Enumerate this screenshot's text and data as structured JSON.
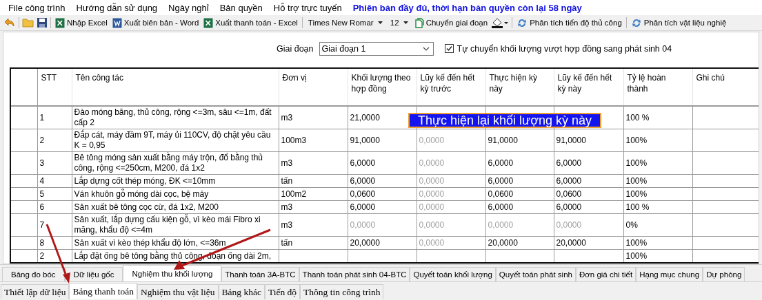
{
  "menu": [
    {
      "label": "File công trình",
      "kind": "normal"
    },
    {
      "label": "Hướng dẫn sử dụng",
      "kind": "normal"
    },
    {
      "label": "Ngày nghỉ",
      "kind": "normal"
    },
    {
      "label": "Bản quyền",
      "kind": "normal"
    },
    {
      "label": "Hỗ trợ trực tuyến",
      "kind": "normal"
    },
    {
      "label": "Phiên bản đầy đủ, thời hạn bản quyền còn lại 58 ngày",
      "kind": "notice"
    }
  ],
  "toolbar": [
    {
      "kind": "icon"
    },
    {
      "kind": "sep"
    },
    {
      "kind": "icon"
    },
    {
      "kind": "icon"
    },
    {
      "kind": "sep"
    },
    {
      "kind": "labeled",
      "label": "Nhập Excel"
    },
    {
      "kind": "labeled",
      "label": "Xuất biên bản - Word"
    },
    {
      "kind": "labeled",
      "label": "Xuất thanh toán - Excel"
    },
    {
      "kind": "sep"
    },
    {
      "kind": "combo",
      "value": "Times New Romar"
    },
    {
      "kind": "combo",
      "value": "12"
    },
    {
      "kind": "labeled",
      "label": "Chuyển giai đoạn"
    },
    {
      "kind": "menu-icon"
    },
    {
      "kind": "sep"
    },
    {
      "kind": "labeled",
      "label": "Phân tích tiến độ thủ công"
    },
    {
      "kind": "sep"
    },
    {
      "kind": "labeled",
      "label": "Phân tích vật liệu nghiệ"
    }
  ],
  "stage": {
    "label": "Giai đoạn",
    "value": "Giai đoạn 1",
    "option": {
      "label": "Tự chuyển khối lượng vượt hợp đồng sang phát sinh 04",
      "checked": true
    }
  },
  "table": {
    "columns": [
      "STT",
      "Tên công tác",
      "Đơn vị",
      "Khối lượng theo hợp đồng",
      "Lũy kế đến hết kỳ trước",
      "Thực hiện kỳ này",
      "Lũy kế đến hết kỳ này",
      "Tỷ lệ hoàn thành",
      "Ghi chú"
    ],
    "rows": [
      {
        "stt": "1",
        "name": "Đào móng băng, thủ công, rộng <=3m, sâu <=1m, đất cấp 2",
        "unit": "m3",
        "values": [
          {
            "text": "21,0000",
            "dim": false
          }
        ],
        "rate": "100 %"
      },
      {
        "stt": "2",
        "name": "Đắp cát, máy đầm 9T, máy ủi 110CV, độ chặt yêu cầu K = 0,95",
        "unit": "100m3",
        "values": [
          {
            "text": "91,0000",
            "dim": false
          },
          {
            "text": "0,0000",
            "dim": true
          },
          {
            "text": "91,0000",
            "dim": false
          },
          {
            "text": "91,0000",
            "dim": false
          }
        ],
        "rate": "100%"
      },
      {
        "stt": "3",
        "name": "Bê tông móng sản xuất bằng máy trộn, đổ bằng thủ công, rộng <=250cm, M200, đá 1x2",
        "unit": "m3",
        "values": [
          {
            "text": "6,0000",
            "dim": false
          },
          {
            "text": "0,0000",
            "dim": true
          },
          {
            "text": "6,0000",
            "dim": false
          },
          {
            "text": "6,0000",
            "dim": false
          }
        ],
        "rate": "100%"
      },
      {
        "stt": "4",
        "name": "Lắp dựng cốt thép móng, ĐK <=10mm",
        "unit": "tấn",
        "values": [
          {
            "text": "6,0000",
            "dim": false
          },
          {
            "text": "0,0000",
            "dim": true
          },
          {
            "text": "6,0000",
            "dim": false
          },
          {
            "text": "6,0000",
            "dim": false
          }
        ],
        "rate": "100%"
      },
      {
        "stt": "5",
        "name": "Ván khuôn gỗ móng dài cọc, bệ máy",
        "unit": "100m2",
        "values": [
          {
            "text": "0,0600",
            "dim": false
          },
          {
            "text": "0,0000",
            "dim": true
          },
          {
            "text": "0,0600",
            "dim": false
          },
          {
            "text": "0,0600",
            "dim": false
          }
        ],
        "rate": "100%"
      },
      {
        "stt": "6",
        "name": "Sản xuất bê tông cọc cừ, đá 1x2, M200",
        "unit": "m3",
        "values": [
          {
            "text": "6,0000",
            "dim": false
          },
          {
            "text": "0,0000",
            "dim": true
          },
          {
            "text": "6,0000",
            "dim": false
          },
          {
            "text": "6,0000",
            "dim": false
          }
        ],
        "rate": "100 %"
      },
      {
        "stt": "7",
        "name": "Sản xuất, lắp dựng cấu kiện gỗ, vì kèo mái Fibro xi măng, khẩu độ <=4m",
        "unit": "m3",
        "values": [
          {
            "text": "0,0000",
            "dim": true
          },
          {
            "text": "0,0000",
            "dim": true
          },
          {
            "text": "0,0000",
            "dim": true
          },
          {
            "text": "0,0000",
            "dim": true
          }
        ],
        "rate": "0%"
      },
      {
        "stt": "8",
        "name": "Sản xuất vì kèo thép khẩu độ lớn, <=36m",
        "unit": "tấn",
        "values": [
          {
            "text": "20,0000",
            "dim": false
          },
          {
            "text": "0,0000",
            "dim": true
          },
          {
            "text": "20,0000",
            "dim": false
          },
          {
            "text": "20,0000",
            "dim": false
          }
        ],
        "rate": "100%"
      },
      {
        "stt": "2",
        "name": "Lắp đặt ống bê tông bằng thủ công, đoạn ống dài 2m,",
        "values": [],
        "rate": "100%"
      }
    ]
  },
  "tooltip": "Thực hiện lại khối lượng kỳ này",
  "sheet_tabs": [
    {
      "label": "Bảng đo bóc",
      "selected": false
    },
    {
      "label": "Dữ liệu gốc",
      "selected": false
    },
    {
      "label": "Nghiệm thu khối lượng",
      "selected": true
    },
    {
      "label": "Thanh toán 3A-BTC",
      "selected": false
    },
    {
      "label": "Thanh toán phát sinh 04-BTC",
      "selected": false
    },
    {
      "label": "Quyết toán khối lượng",
      "selected": false
    },
    {
      "label": "Quyết toán phát sinh",
      "selected": false
    },
    {
      "label": "Đơn giá chi tiết",
      "selected": false
    },
    {
      "label": "Hạng mục chung",
      "selected": false
    },
    {
      "label": "Dự phòng",
      "selected": false
    }
  ],
  "main_tabs": [
    {
      "label": "Thiết lập dữ liệu",
      "selected": false
    },
    {
      "label": "Bảng thanh toán",
      "selected": true
    },
    {
      "label": "Nghiệm thu vật liệu",
      "selected": false
    },
    {
      "label": "Bảng khác",
      "selected": false
    },
    {
      "label": "Tiến độ",
      "selected": false
    },
    {
      "label": "Thông tin công trình",
      "selected": false
    }
  ]
}
